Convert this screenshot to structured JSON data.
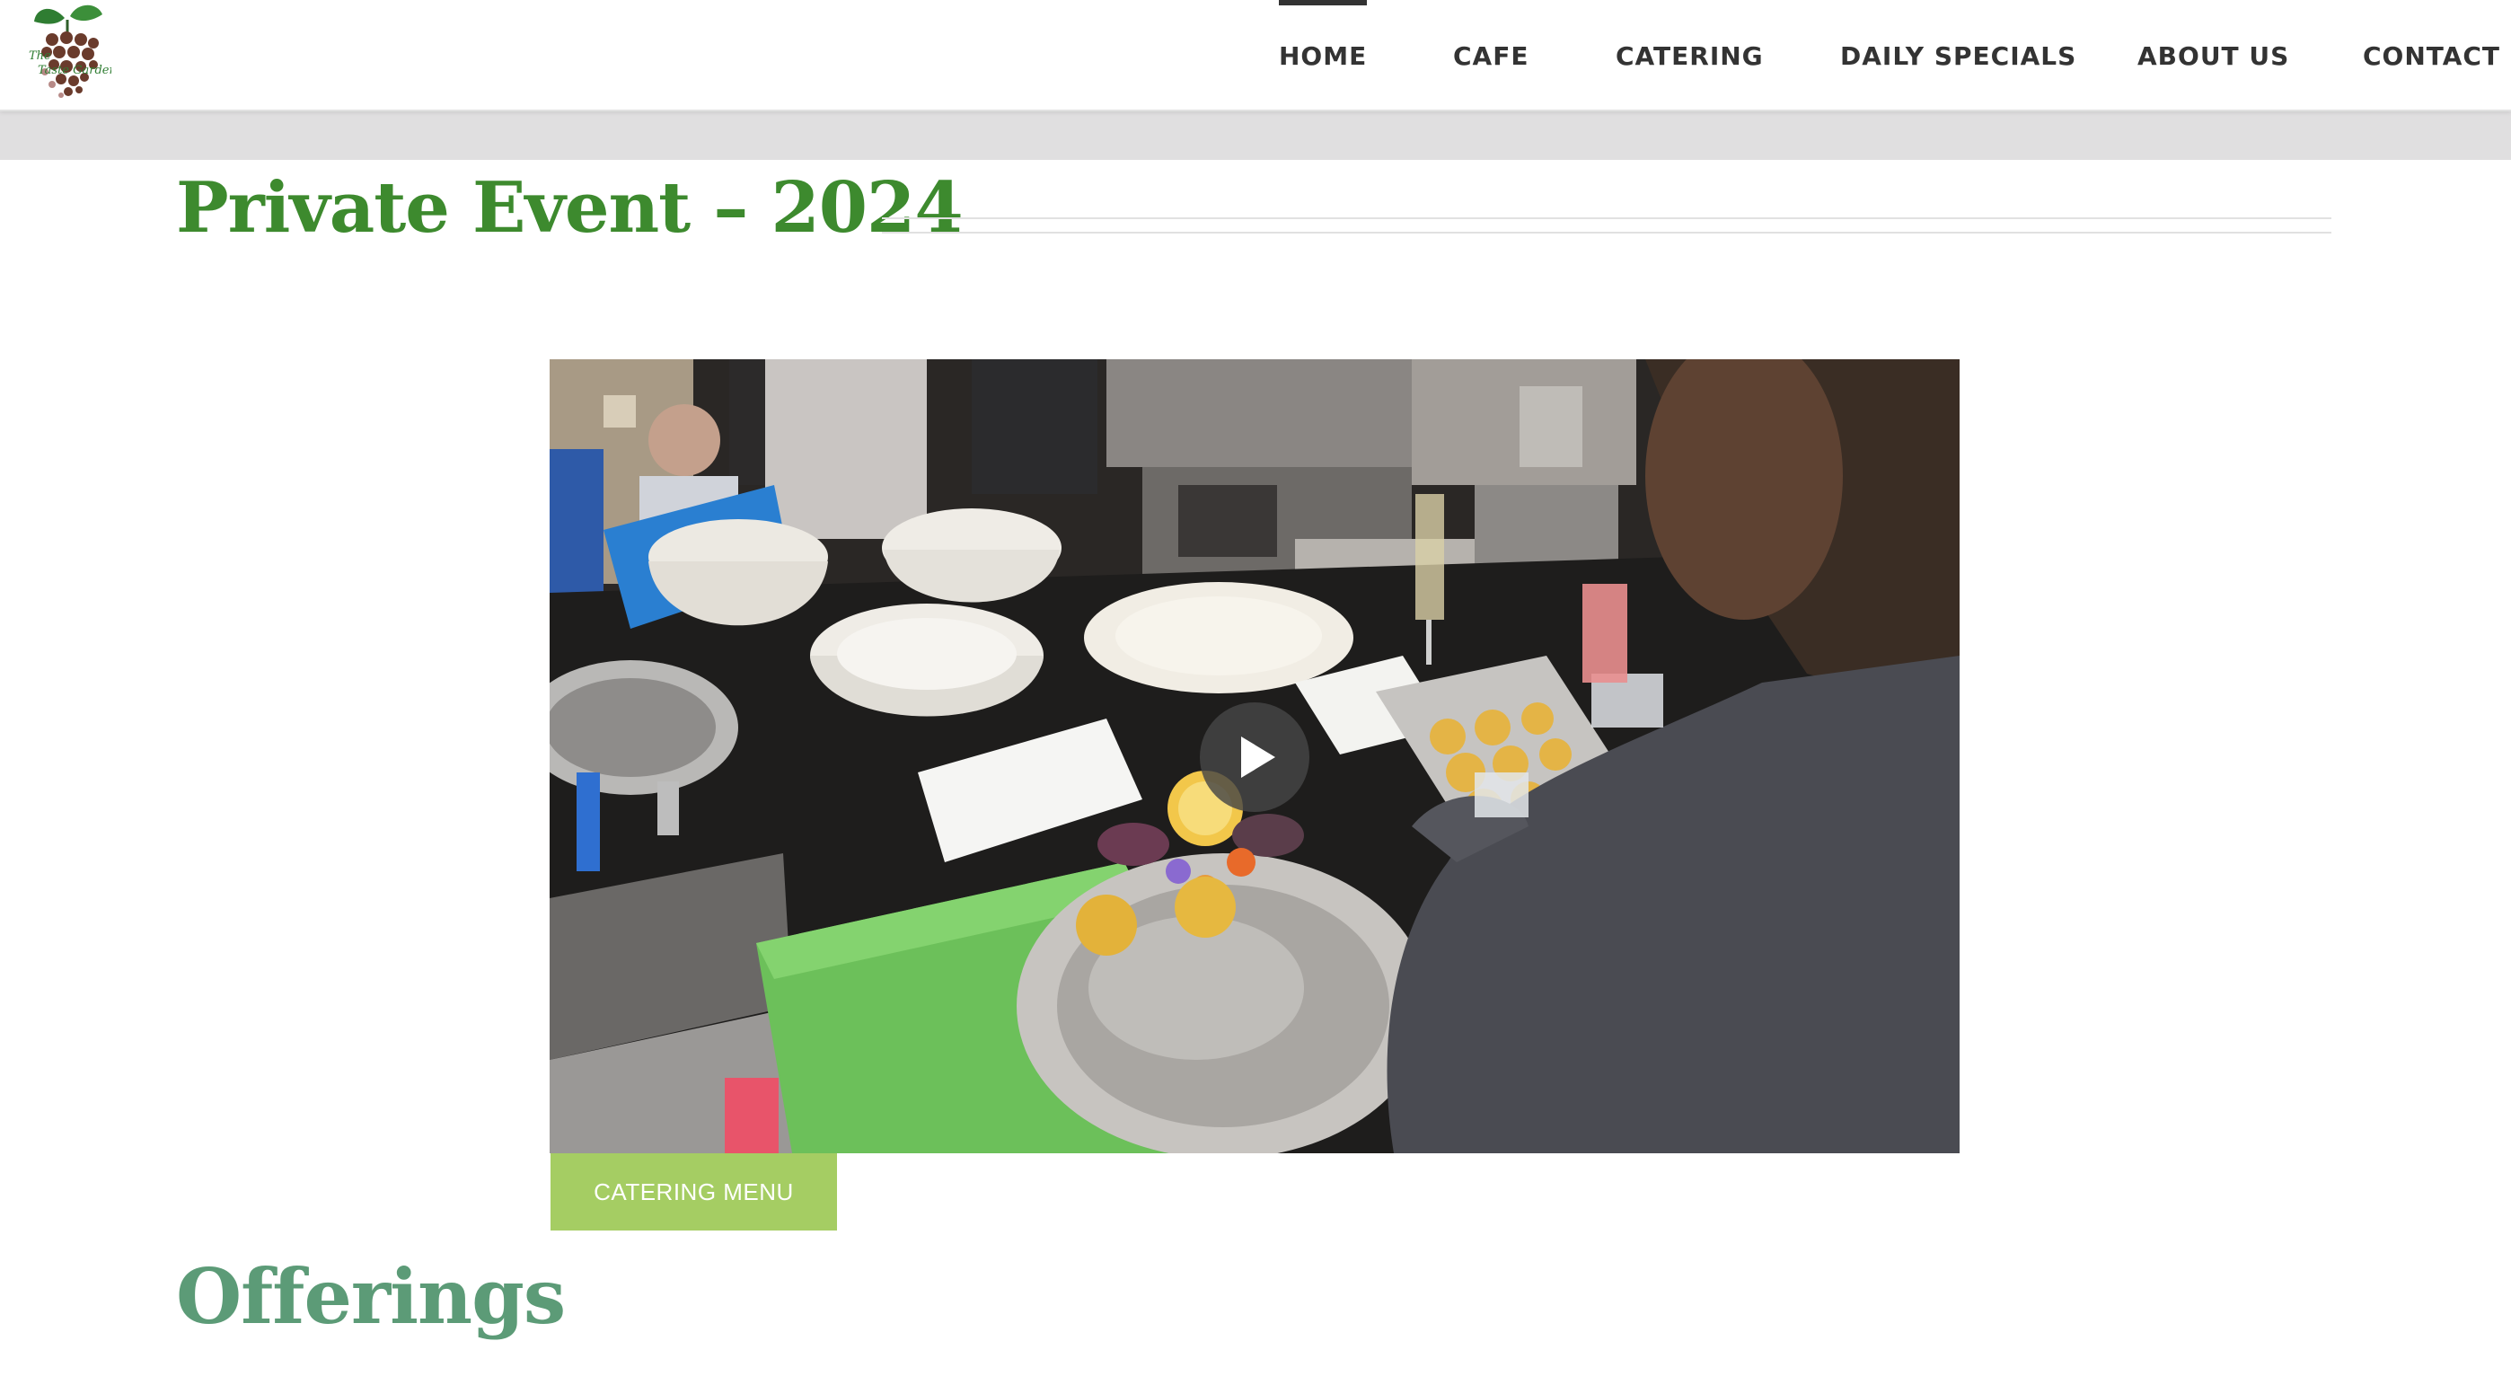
{
  "header": {
    "logo_text": "The Taste Garden",
    "nav": [
      {
        "label": "HOME",
        "active": true
      },
      {
        "label": "CAFE",
        "active": false
      },
      {
        "label": "CATERING",
        "active": false
      },
      {
        "label": "DAILY SPECIALS",
        "active": false
      },
      {
        "label": "ABOUT US",
        "active": false
      },
      {
        "label": "CONTACT",
        "active": false
      }
    ]
  },
  "main": {
    "title": "Private Event – 2024",
    "video": {
      "play_icon": "play-icon"
    },
    "catering_button_label": "CATERING MENU",
    "offerings_heading": "Offerings"
  },
  "colors": {
    "title_green": "#3d8a2e",
    "offerings_green": "#5c9b77",
    "button_green": "#a5cd63",
    "nav_text": "#333333"
  }
}
